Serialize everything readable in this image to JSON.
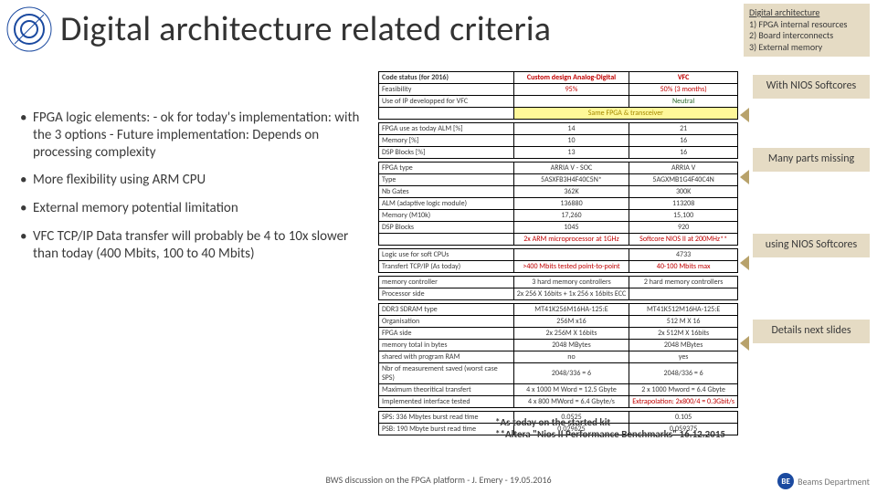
{
  "header": {
    "title": "Digital architecture related criteria"
  },
  "topcard": {
    "h": "Digital architecture",
    "l1": "1) FPGA internal resources",
    "l2": "2) Board interconnects",
    "l3": "3) External memory"
  },
  "bullets": [
    "FPGA logic elements:\n- ok for today's implementation: with the 3 options\n- Future implementation: Depends on processing complexity",
    "More flexibility using ARM CPU",
    "External memory potential limitation",
    "VFC TCP/IP Data transfer will probably be 4 to 10x slower than today (400 Mbits, 100 to 40 Mbits)"
  ],
  "rboxes": [
    "With NIOS Softcores",
    "Many parts missing",
    "using NIOS Softcores",
    "Details next slides"
  ],
  "table": {
    "groups": [
      {
        "rows": [
          [
            "Code status (for 2016)",
            "Custom design Analog-Digital",
            "VFC"
          ],
          [
            "Feasibility",
            "95%",
            "50% (3 months)"
          ],
          [
            "Use of IP developped for VFC",
            "",
            "Neutral"
          ],
          [
            "",
            "Same FPGA & transceiver",
            ""
          ]
        ],
        "classFor": {
          "0_1": "red",
          "0_2": "red",
          "1_1": "red",
          "1_2": "red",
          "2_2": "grn",
          "3_1": "yel"
        }
      },
      {
        "rows": [
          [
            "FPGA use as today ALM [%]",
            "14",
            "21"
          ],
          [
            "Memory [%]",
            "10",
            "16"
          ],
          [
            "DSP Blocks [%]",
            "13",
            "16"
          ]
        ]
      },
      {
        "rows": [
          [
            "FPGA type",
            "ARRIA V - SOC",
            "ARRIA V"
          ],
          [
            "Type",
            "5ASXFB3H4F40C5N*",
            "5AGXMB1G4F40C4N"
          ],
          [
            "Nb Gates",
            "362K",
            "300K"
          ],
          [
            "ALM (adaptive logic module)",
            "136880",
            "113208"
          ],
          [
            "Memory (M10k)",
            "17,260",
            "15,100"
          ],
          [
            "DSP Blocks",
            "1045",
            "920"
          ],
          [
            "",
            "2x ARM microprocessor at 1GHz",
            "Softcore NIOS II at 200MHz**"
          ]
        ],
        "classFor": {
          "6_1": "red",
          "6_2": "red"
        }
      },
      {
        "rows": [
          [
            "Logic use for soft CPUs",
            "",
            "4733"
          ],
          [
            "Transfert TCP/IP (As today)",
            ">400 Mbits tested point-to-point",
            "40-100 Mbits max"
          ]
        ],
        "classFor": {
          "1_1": "red",
          "1_2": "red"
        }
      },
      {
        "rows": [
          [
            "memory controller",
            "3 hard memory controllers",
            "2 hard memory controllers"
          ],
          [
            "Processor side",
            "2x 256 X 16bits + 1x 256 x 16bits ECC",
            ""
          ]
        ]
      },
      {
        "rows": [
          [
            "DDR3 SDRAM type",
            "MT41K256M16HA-125:E",
            "MT41K512M16HA-125:E"
          ],
          [
            "Organisation",
            "256M x16",
            "512 M X 16"
          ],
          [
            "FPGA side",
            "2x 256M X 16bits",
            "2x 512M X 16bits"
          ],
          [
            "memory total in bytes",
            "2048 MBytes",
            "2048 MBytes"
          ],
          [
            "shared with program RAM",
            "no",
            "yes"
          ],
          [
            "Nbr of measurement saved (worst case SPS)",
            "2048/336 = 6",
            "2048/336 = 6"
          ],
          [
            "Maximum theoritical transfert",
            "4 x 1000 M Word = 12.5 Gbyte",
            "2 x 1000 Mword = 6.4 Gbyte"
          ],
          [
            "Implemented interface tested",
            "4 x 800 MWord = 6.4 Gbyte/s",
            "Extrapolation: 2x800/4 = 0.3Gbit/s"
          ]
        ],
        "classFor": {
          "7_2": "red"
        }
      },
      {
        "rows": [
          [
            "SPS: 336 Mbytes burst read time",
            "0.0525",
            "0.105"
          ],
          [
            "PSB: 190 Mbyte burst read time",
            "0.029625",
            "0.059375"
          ]
        ]
      }
    ]
  },
  "footnotes": {
    "f1": "*As today on the started kit",
    "f2": "**Altera \"Nios II Performance Benchmarks\" 16.12.2015"
  },
  "footer": "BWS discussion on the FPGA platform - J. Emery - 19.05.2016",
  "be": {
    "badge": "BE",
    "label": "Beams Department"
  }
}
